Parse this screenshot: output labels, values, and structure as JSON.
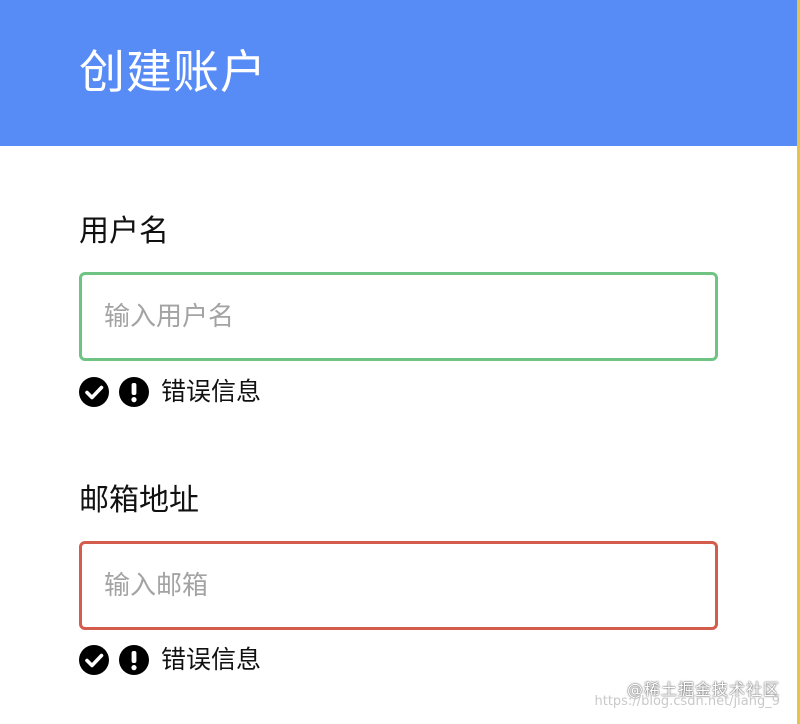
{
  "colors": {
    "header_bg": "#578bf5",
    "side_rule": "#e3c54a",
    "valid_border": "#6fc483",
    "error_border": "#d35c4d",
    "icon_fill": "#000000"
  },
  "header": {
    "title": "创建账户"
  },
  "form": {
    "username": {
      "label": "用户名",
      "placeholder": "输入用户名",
      "value": "",
      "state": "success",
      "message": "错误信息",
      "icons": [
        "check-circle-icon",
        "exclamation-circle-icon"
      ]
    },
    "email": {
      "label": "邮箱地址",
      "placeholder": "输入邮箱",
      "value": "",
      "state": "error",
      "message": "错误信息",
      "icons": [
        "check-circle-icon",
        "exclamation-circle-icon"
      ]
    }
  },
  "watermark": {
    "main": "@稀土掘金技术社区",
    "url": "https://blog.csdn.net/jiang_9"
  }
}
